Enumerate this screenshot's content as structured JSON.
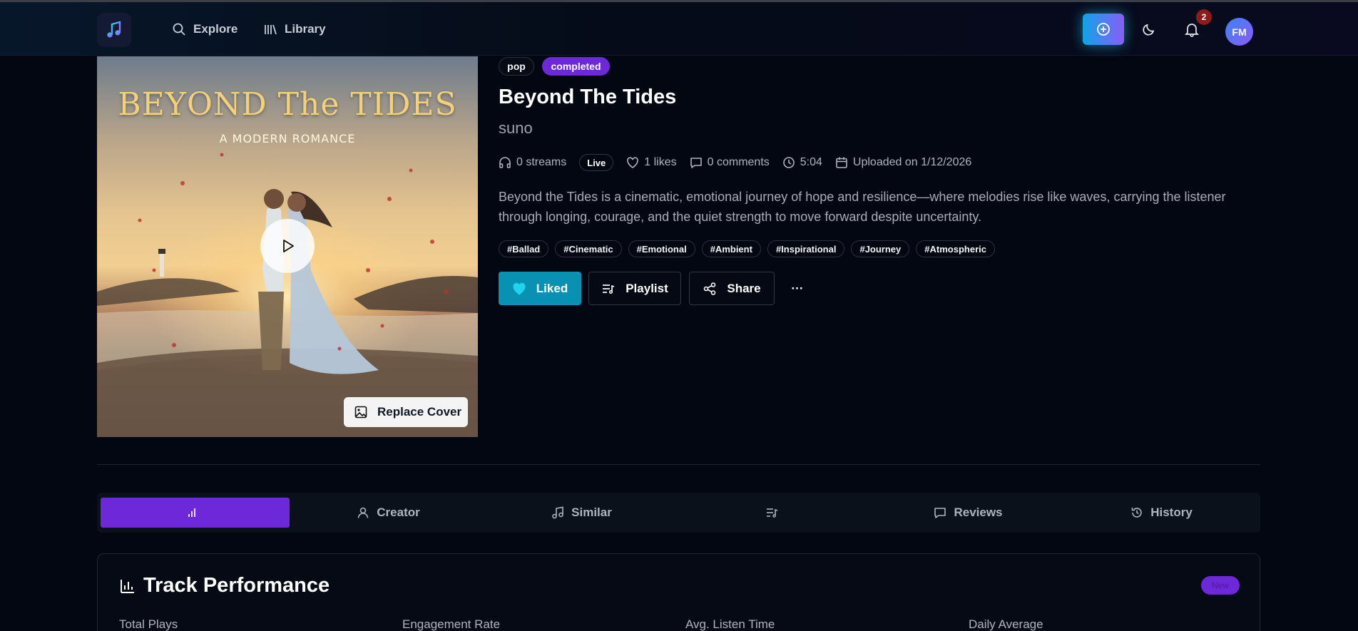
{
  "header": {
    "nav": [
      {
        "label": "Explore",
        "icon": "search-icon"
      },
      {
        "label": "Library",
        "icon": "library-icon"
      }
    ],
    "notifications_count": "2",
    "avatar_initials": "FM"
  },
  "cover": {
    "art_title": "BEYOND The TIDES",
    "art_subtitle": "A MODERN ROMANCE",
    "replace_label": "Replace Cover"
  },
  "track": {
    "genre": "pop",
    "status": "completed",
    "title": "Beyond The Tides",
    "artist": "suno",
    "streams": "0 streams",
    "live_label": "Live",
    "likes": "1 likes",
    "comments": "0 comments",
    "duration": "5:04",
    "uploaded": "Uploaded on 1/12/2026",
    "description": "Beyond the Tides is a cinematic, emotional journey of hope and resilience—where melodies rise like waves, carrying the listener through longing, courage, and the quiet strength to move forward despite uncertainty.",
    "tags": [
      "#Ballad",
      "#Cinematic",
      "#Emotional",
      "#Ambient",
      "#Inspirational",
      "#Journey",
      "#Atmospheric"
    ]
  },
  "actions": {
    "liked": "Liked",
    "playlist": "Playlist",
    "share": "Share",
    "more": "···"
  },
  "tabs": [
    {
      "label": "",
      "icon": "bar-chart-icon",
      "active": true
    },
    {
      "label": "Creator",
      "icon": "user-icon"
    },
    {
      "label": "Similar",
      "icon": "music-note-icon"
    },
    {
      "label": "",
      "icon": "list-music-icon"
    },
    {
      "label": "Reviews",
      "icon": "message-icon"
    },
    {
      "label": "History",
      "icon": "history-icon"
    }
  ],
  "performance": {
    "title": "Track Performance",
    "badge": "New",
    "metrics": [
      "Total Plays",
      "Engagement Rate",
      "Avg. Listen Time",
      "Daily Average"
    ]
  },
  "colors": {
    "accent": "#6d28d9",
    "liked": "#0891b2",
    "background": "#030712"
  }
}
